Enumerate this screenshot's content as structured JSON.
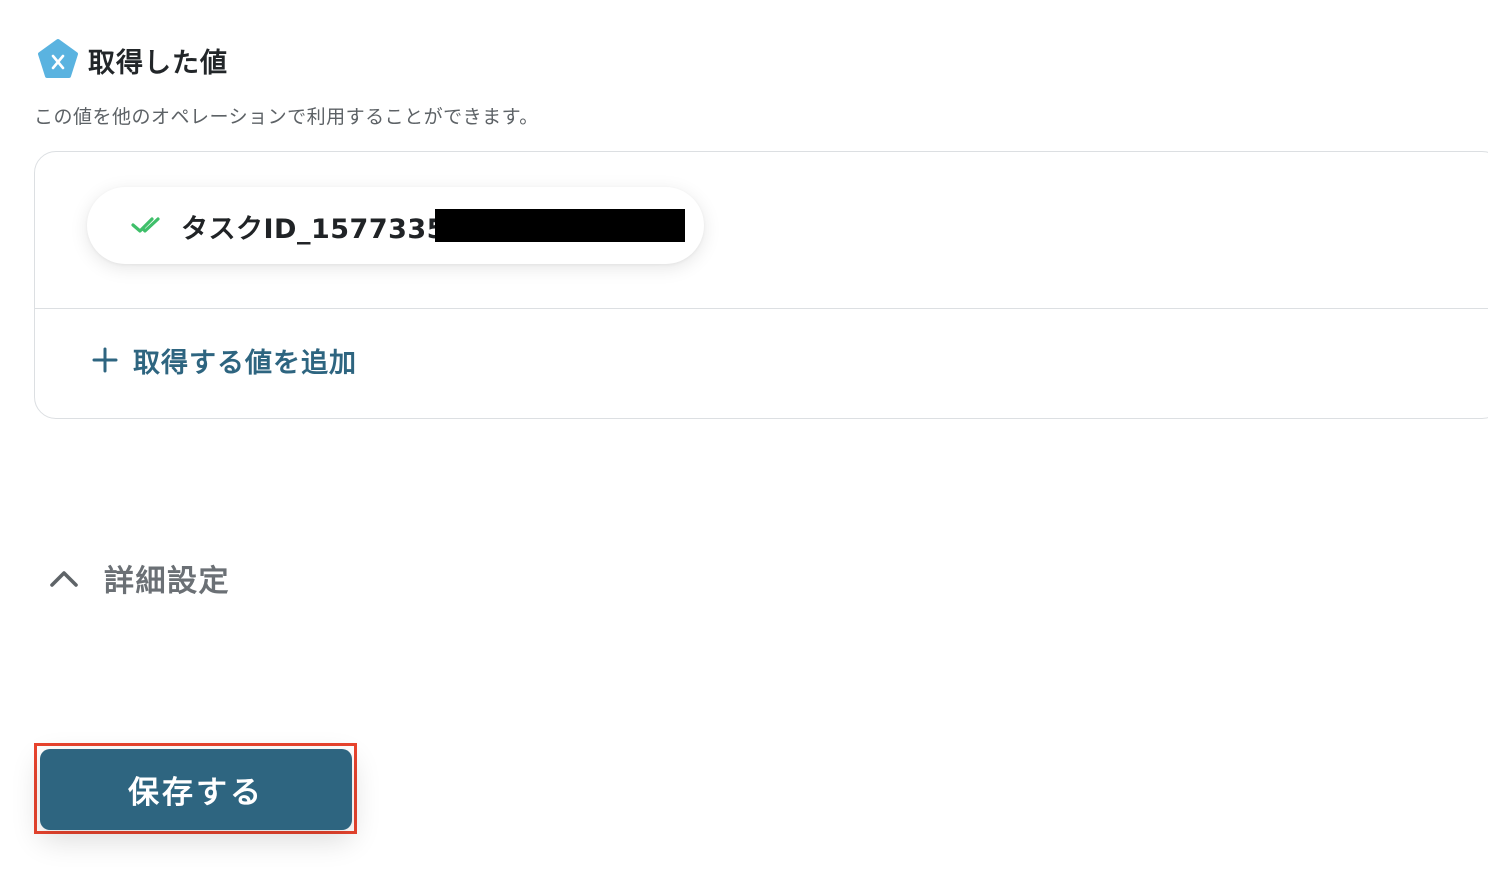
{
  "section": {
    "title": "取得した値",
    "description": "この値を他のオペレーションで利用することができます。",
    "icon": "variable-x-icon"
  },
  "values": {
    "items": [
      {
        "label": "タスクID_1577335",
        "status_icon": "double-check-icon",
        "redacted": true
      }
    ],
    "add_label": "取得する値を追加"
  },
  "advanced": {
    "label": "詳細設定",
    "expanded": true
  },
  "actions": {
    "save_label": "保存する"
  },
  "colors": {
    "accent": "#2e6580",
    "icon_blue": "#5ab3e0",
    "check_green": "#3fbf6a",
    "highlight_red": "#e8442e"
  }
}
